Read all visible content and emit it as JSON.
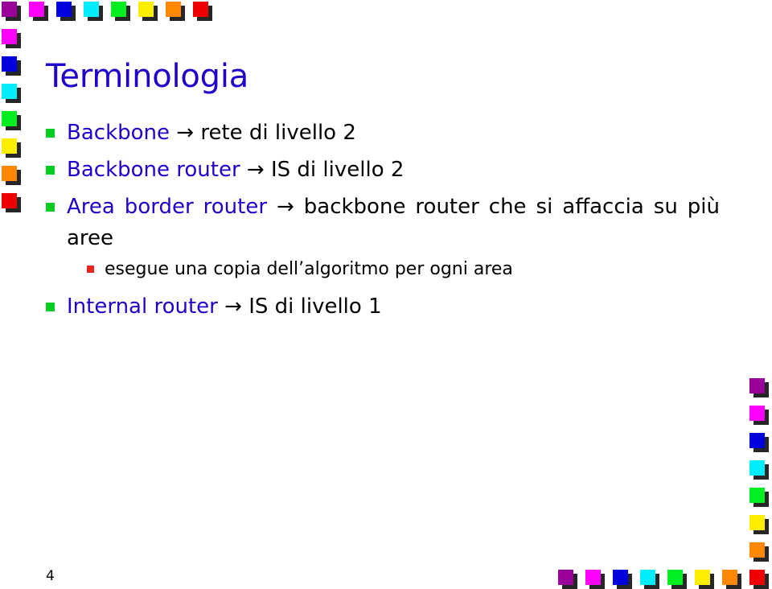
{
  "slide": {
    "title": "Terminologia",
    "page_number": "4",
    "title_color": "#2200cc",
    "keyword_color": "#2200cc",
    "body_color": "#000000",
    "background_color": "#ffffff",
    "level1_bullet_color": "#00cc22",
    "level2_bullet_color": "#e8221e",
    "bullets": [
      {
        "level": 1,
        "keyword": "Backbone",
        "arrow": " → ",
        "rest": "rete di livello 2",
        "justify": false
      },
      {
        "level": 1,
        "keyword": "Backbone router",
        "arrow": " → ",
        "rest": "IS di livello 2",
        "justify": false
      },
      {
        "level": 1,
        "keyword": "Area border router",
        "arrow": " → ",
        "rest": "backbone router che si affaccia su più aree",
        "justify": true
      },
      {
        "level": 2,
        "keyword": "",
        "arrow": "",
        "rest": "esegue una copia dell’algoritmo per ogni area",
        "justify": false
      },
      {
        "level": 1,
        "keyword": "Internal router",
        "arrow": " → ",
        "rest": "IS di livello 1",
        "justify": false
      }
    ]
  },
  "decorations": {
    "shadow_color": "#262626",
    "palette": {
      "purple": "#990099",
      "magenta": "#ff00ff",
      "blue": "#0000dd",
      "cyan": "#00eeff",
      "green": "#00ee22",
      "yellow": "#ffee00",
      "orange": "#ff8800",
      "red": "#ee0000"
    },
    "top_row": [
      "purple",
      "magenta",
      "blue",
      "cyan",
      "green",
      "yellow",
      "orange",
      "red"
    ],
    "left_column": [
      "magenta",
      "blue",
      "cyan",
      "green",
      "yellow",
      "orange",
      "red"
    ],
    "right_column": [
      "purple",
      "magenta",
      "blue",
      "cyan",
      "green",
      "yellow",
      "orange"
    ],
    "bottom_row": [
      "purple",
      "magenta",
      "blue",
      "cyan",
      "green",
      "yellow",
      "orange",
      "red"
    ]
  }
}
